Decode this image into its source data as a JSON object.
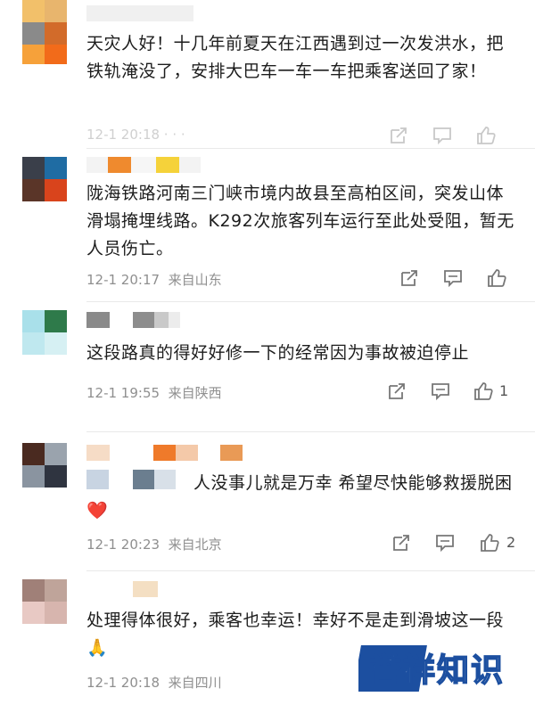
{
  "comments": [
    {
      "text": "天灾人好！十几年前夏天在江西遇到过一次发洪水，把铁轨淹没了，安排大巴车一车一车把乘客送回了家！",
      "time": "",
      "location": "",
      "likes": ""
    },
    {
      "text": "陇海铁路河南三门峡市境内故县至高柏区间，突发山体滑塌掩埋线路。K292次旅客列车运行至此处受阻，暂无人员伤亡。",
      "time": "12-1 20:17",
      "location": "来自山东",
      "likes": ""
    },
    {
      "text": "这段路真的得好好修一下的经常因为事故被迫停止",
      "time": "12-1 19:55",
      "location": "来自陕西",
      "likes": "1"
    },
    {
      "text": "人没事儿就是万幸 希望尽快能够救援脱困",
      "emoji": "❤️",
      "time": "12-1 20:23",
      "location": "来自北京",
      "likes": "2"
    },
    {
      "text": "处理得体很好，乘客也幸运！幸好不是走到滑坡这一段",
      "emoji": "🙏",
      "time": "12-1 20:18",
      "location": "来自四川",
      "likes": ""
    }
  ],
  "watermark": {
    "text": "誉祥知识",
    "colors": {
      "dark": "#1c4fa0",
      "light": "#ffffff"
    }
  },
  "icons": [
    "share-icon",
    "comment-icon",
    "like-icon"
  ]
}
